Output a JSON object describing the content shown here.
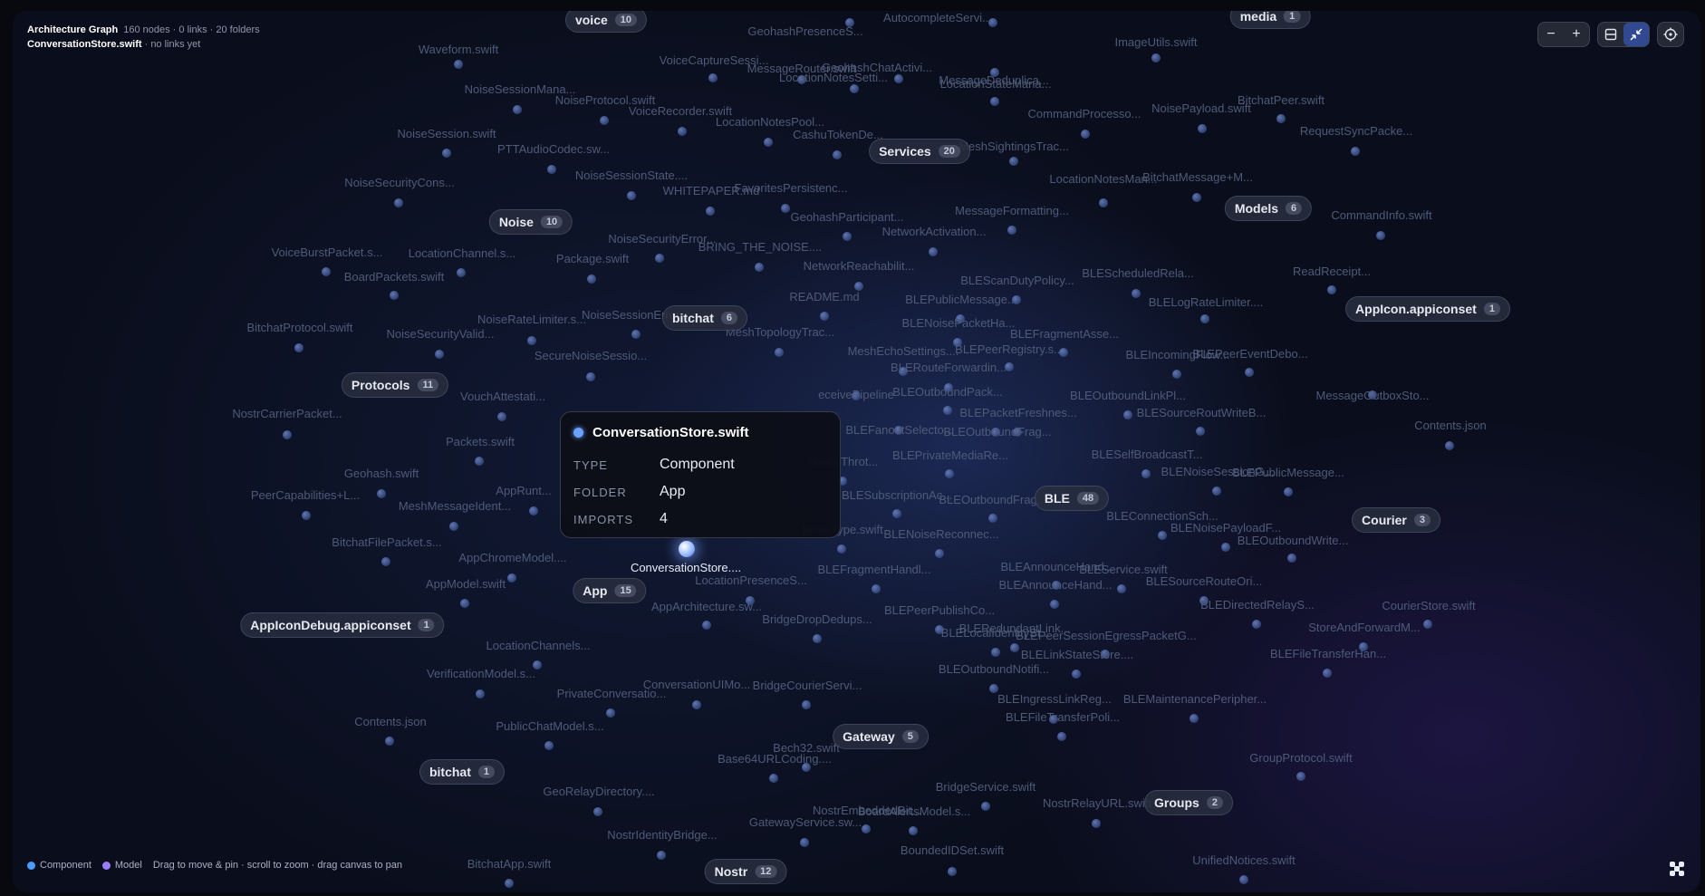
{
  "header": {
    "title": "Architecture Graph",
    "stats": "160 nodes · 0 links · 20 folders",
    "focus_file": "ConversationStore.swift",
    "focus_note": "· no links yet"
  },
  "toolbar": {
    "zoom_out": "−",
    "zoom_in": "+"
  },
  "tooltip": {
    "title": "ConversationStore.swift",
    "rows": [
      {
        "key": "TYPE",
        "value": "Component"
      },
      {
        "key": "FOLDER",
        "value": "App"
      },
      {
        "key": "IMPORTS",
        "value": "4"
      }
    ]
  },
  "legend": {
    "items": [
      {
        "label": "Component",
        "color": "#4a9cff"
      },
      {
        "label": "Model",
        "color": "#9a7cff"
      }
    ],
    "hint": "Drag to move & pin · scroll to zoom · drag canvas to pan"
  },
  "active_node": {
    "label": "ConversationStore...."
  },
  "clusters": [
    {
      "name": "voice",
      "count": "10"
    },
    {
      "name": "media",
      "count": "1"
    },
    {
      "name": "Services",
      "count": "20"
    },
    {
      "name": "Models",
      "count": "6"
    },
    {
      "name": "Noise",
      "count": "10"
    },
    {
      "name": "bitchat",
      "count": "6"
    },
    {
      "name": "AppIcon.appiconset",
      "count": "1"
    },
    {
      "name": "Protocols",
      "count": "11"
    },
    {
      "name": "BLE",
      "count": "48"
    },
    {
      "name": "Courier",
      "count": "3"
    },
    {
      "name": "App",
      "count": "15"
    },
    {
      "name": "AppIconDebug.appiconset",
      "count": "1"
    },
    {
      "name": "Gateway",
      "count": "5"
    },
    {
      "name": "bitchat",
      "count": "1"
    },
    {
      "name": "Groups",
      "count": "2"
    },
    {
      "name": "Nostr",
      "count": "12"
    }
  ],
  "files": [
    "Waveform.swift",
    "GeohashPresenceS...",
    "AutocompleteServi...",
    "ImageUtils.swift",
    "VoiceCaptureSessi...",
    "MessageRouter.swift",
    "GeohashChatActivi...",
    "MessageDeduplica...",
    "LocationNotesSetti...",
    "LocationStateMana...",
    "NoiseSessionMana...",
    "BitchatPeer.swift",
    "NoiseProtocol.swift",
    "VoiceRecorder.swift",
    "NoisePayload.swift",
    "LocationNotesPool...",
    "CommandProcesso...",
    "NoiseSession.swift",
    "CashuTokenDe...",
    "RequestSyncPacke...",
    "PTTAudioCodec.sw...",
    "MeshSightingsTrac...",
    "NoiseSessionState....",
    "BitchatMessage+M...",
    "NoiseSecurityCons...",
    "FavoritesPersistenc...",
    "LocationNotesMan...",
    "WHITEPAPER.md",
    "GeohashParticipant...",
    "MessageFormatting...",
    "CommandInfo.swift",
    "NetworkActivation...",
    "NoiseSecurityError...",
    "BRING_THE_NOISE....",
    "VoiceBurstPacket.s...",
    "LocationChannel.s...",
    "Package.swift",
    "NetworkReachabilit...",
    "BLEScheduledRela...",
    "BoardPackets.swift",
    "BLEScanDutyPolicy...",
    "ReadReceipt...",
    "README.md",
    "BLEPublicMessage...",
    "BLELogRateLimiter....",
    "BitchatProtocol.swift",
    "NoiseRateLimiter.s...",
    "NoiseSessionError....",
    "MeshTopologyTrac...",
    "BLENoisePacketHa...",
    "BLEFragmentAsse...",
    "NoiseSecurityValid...",
    "SecureNoiseSessio...",
    "MeshEchoSettings....",
    "BLEPeerRegistry.s...",
    "BLEIncomingFlow...",
    "BLEPeerEventDebo...",
    "BLERouteForwardin...",
    "NostrCarrierPacket...",
    "VouchAttestati...",
    "eceivePipeline",
    "BLEOutboundPack...",
    "BLEOutboundLinkPl...",
    "MessageOutboxSto...",
    "BLESourceRoutWriteB...",
    "BLEPacketFreshnes...",
    "Contents.json",
    "Packets.swift",
    "BLEFanoutSelecto...",
    "BLEOutboundFrag...",
    "BLESelfBroadcastT...",
    "BLEPrivateMediaRe...",
    "ounceThrot...",
    "BLENoiseSessionG...",
    "BLEPublicMessage...",
    "Geohash.swift",
    "PeerCapabilities+L...",
    "AppRunt...",
    "BLESubscriptionAc...",
    "BLEOutboundFrag...",
    "MeshMessageIdent...",
    "BLEConnectionSch...",
    "BLENoisePayloadF...",
    "MimeType.swift",
    "BitchatFilePacket.s...",
    "BLENoiseReconnec...",
    "BLEOutboundWrite...",
    "AppChromeModel....",
    "BLEAnnounceHand...",
    "BLEService.swift",
    "BLEFragmentHandl...",
    "LocationPresenceS...",
    "BLEAnnounceHand...",
    "BLESourceRouteOri...",
    "AppModel.swift",
    "BLEPeerPublishCo...",
    "BLEDirectedRelayS...",
    "AppArchitecture.sw...",
    "CourierStore.swift",
    "BLELocalIdentitySt...",
    "BLERedundantLink...",
    "BLEPeerSessionEgressPacketG...",
    "BridgeDropDedups...",
    "LocationChannels...",
    "BLELinkStateStore....",
    "StoreAndForwardM...",
    "BLEFileTransferHan...",
    "BLEOutboundNotifi...",
    "VerificationModel.s...",
    "ConversationUIMo...",
    "BridgeCourierServi...",
    "PrivateConversatio...",
    "BLEIngressLinkReg...",
    "BLEMaintenancePeripher...",
    "Contents.json",
    "BLEFileTransferPoli...",
    "PublicChatModel.s...",
    "Bech32.swift",
    "Base64URLCoding....",
    "GroupProtocol.swift",
    "GeoRelayDirectory....",
    "BridgeService.swift",
    "NostrRelayURL.swift",
    "BoardAlertsModel.s...",
    "NostrEmbeddedBit...",
    "GatewayService.sw...",
    "NostrIdentityBridge...",
    "BoundedIDSet.swift",
    "UnifiedNotices.swift",
    "BitchatApp.swift"
  ]
}
